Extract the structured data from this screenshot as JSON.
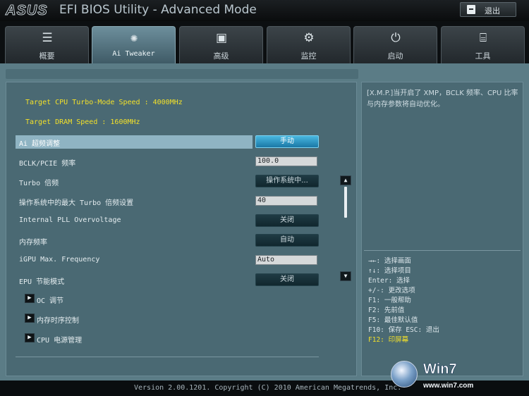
{
  "header": {
    "brand": "ASUS",
    "title": "EFI BIOS Utility - Advanced Mode",
    "exit_label": "退出"
  },
  "tabs": [
    {
      "label": "概要",
      "icon": "list-icon"
    },
    {
      "label": "Ai Tweaker",
      "icon": "tweaker-icon",
      "active": true
    },
    {
      "label": "高级",
      "icon": "advanced-icon"
    },
    {
      "label": "监控",
      "icon": "monitor-icon"
    },
    {
      "label": "启动",
      "icon": "power-icon"
    },
    {
      "label": "工具",
      "icon": "tool-icon"
    }
  ],
  "info": {
    "cpu_speed": "Target CPU Turbo-Mode Speed : 4000MHz",
    "dram_speed": "Target DRAM Speed : 1600MHz"
  },
  "settings": [
    {
      "label": "Ai 超频调整",
      "value": "手动",
      "type": "button",
      "selected": true
    },
    {
      "label": "BCLK/PCIE 频率",
      "value": "100.0",
      "type": "input"
    },
    {
      "label": "Turbo 倍频",
      "value": "操作系统中...",
      "type": "button"
    },
    {
      "label": "操作系统中的最大 Turbo 倍频设置",
      "value": "40",
      "type": "input"
    },
    {
      "label": "Internal PLL Overvoltage",
      "value": "关闭",
      "type": "button"
    },
    {
      "label": "内存频率",
      "value": "自动",
      "type": "button"
    },
    {
      "label": "iGPU Max. Frequency",
      "value": "Auto",
      "type": "input"
    },
    {
      "label": "EPU 节能模式",
      "value": "关闭",
      "type": "button"
    }
  ],
  "submenus": [
    "OC 调节",
    "内存时序控制",
    "CPU 电源管理"
  ],
  "help": "[X.M.P.]当开启了 XMP，BCLK 频率、CPU 比率与内存参数将自动优化。",
  "hotkeys": [
    "→←: 选择画面",
    "↑↓: 选择项目",
    "Enter: 选择",
    "+/-: 更改选项",
    "F1: 一般帮助",
    "F2: 先前值",
    "F5: 最佳默认值",
    "F10: 保存  ESC: 退出",
    "F12: 印屏幕"
  ],
  "footer": "Version 2.00.1201. Copyright (C) 2010 American Megatrends, Inc.",
  "watermark": {
    "title": "Win7",
    "url": "www.win7.com"
  },
  "colors": {
    "accent": "#f2e02a",
    "selected_button": "#2b9ccb",
    "panel": "#4a6973"
  }
}
